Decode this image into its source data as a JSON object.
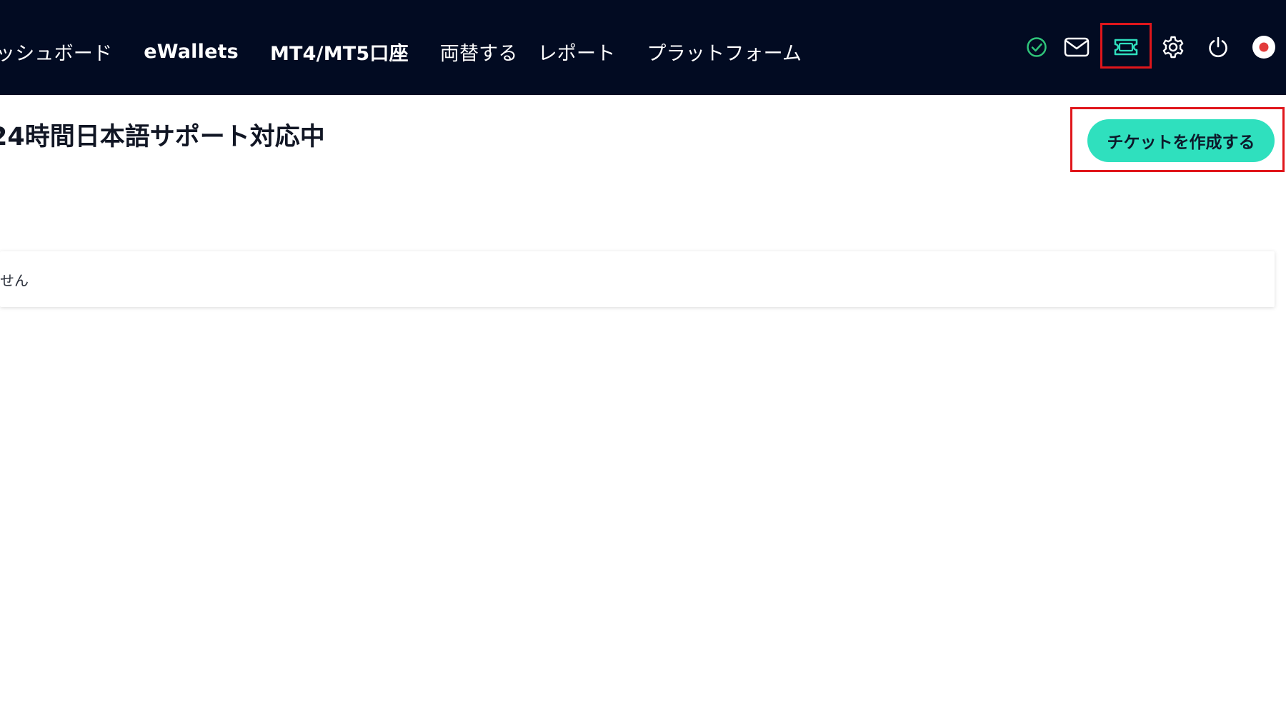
{
  "nav": {
    "items": [
      {
        "label": "ッシュボード"
      },
      {
        "label": "eWallets"
      },
      {
        "label": "MT4/MT5口座"
      },
      {
        "label": "両替する"
      },
      {
        "label": "レポート"
      },
      {
        "label": "プラットフォーム"
      }
    ]
  },
  "header_icons": [
    {
      "name": "verified-check-icon",
      "color": "#2fc47a"
    },
    {
      "name": "mail-icon",
      "color": "#ffffff"
    },
    {
      "name": "ticket-icon",
      "color": "#2fe0be"
    },
    {
      "name": "gear-icon",
      "color": "#ffffff"
    },
    {
      "name": "power-icon",
      "color": "#ffffff"
    },
    {
      "name": "flag-icon",
      "color": "#e23b3b"
    }
  ],
  "main": {
    "title": "24時間日本語サポート対応中",
    "create_button_label": "チケットを作成する",
    "empty_message": "せん"
  },
  "colors": {
    "topbar_bg": "#020b22",
    "accent": "#2fe0be",
    "highlight": "#e0161b"
  }
}
